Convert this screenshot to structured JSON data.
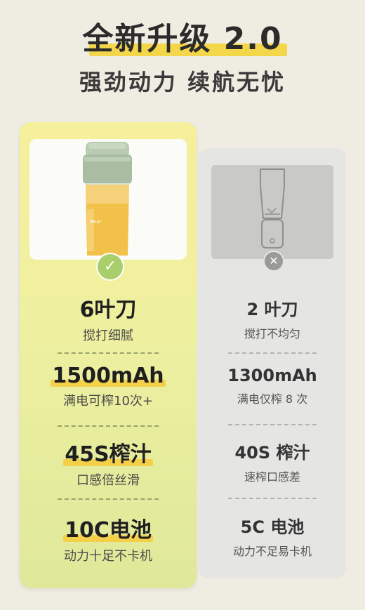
{
  "header": {
    "title": "全新升级 2.0",
    "subtitle": "强劲动力  续航无忧"
  },
  "new_product": {
    "features": [
      {
        "main": "6叶刀",
        "sub": "搅打细腻"
      },
      {
        "main": "1500mAh",
        "sub": "满电可榨10次+"
      },
      {
        "main": "45S榨汁",
        "sub": "口感倍丝滑"
      },
      {
        "main": "10C电池",
        "sub": "动力十足不卡机"
      }
    ],
    "badge_icon": "check-icon"
  },
  "old_product": {
    "features": [
      {
        "main": "2 叶刀",
        "sub": "搅打不均匀"
      },
      {
        "main": "1300mAh",
        "sub": "满电仅榨 8 次"
      },
      {
        "main": "40S 榨汁",
        "sub": "速榨口感差"
      },
      {
        "main": "5C 电池",
        "sub": "动力不足易卡机"
      }
    ],
    "badge_icon": "x-icon"
  },
  "colors": {
    "highlight": "#f4d04a",
    "new_card": "#eef0a0",
    "old_card": "#e5e5e3",
    "check_badge": "#a9cf6a"
  }
}
